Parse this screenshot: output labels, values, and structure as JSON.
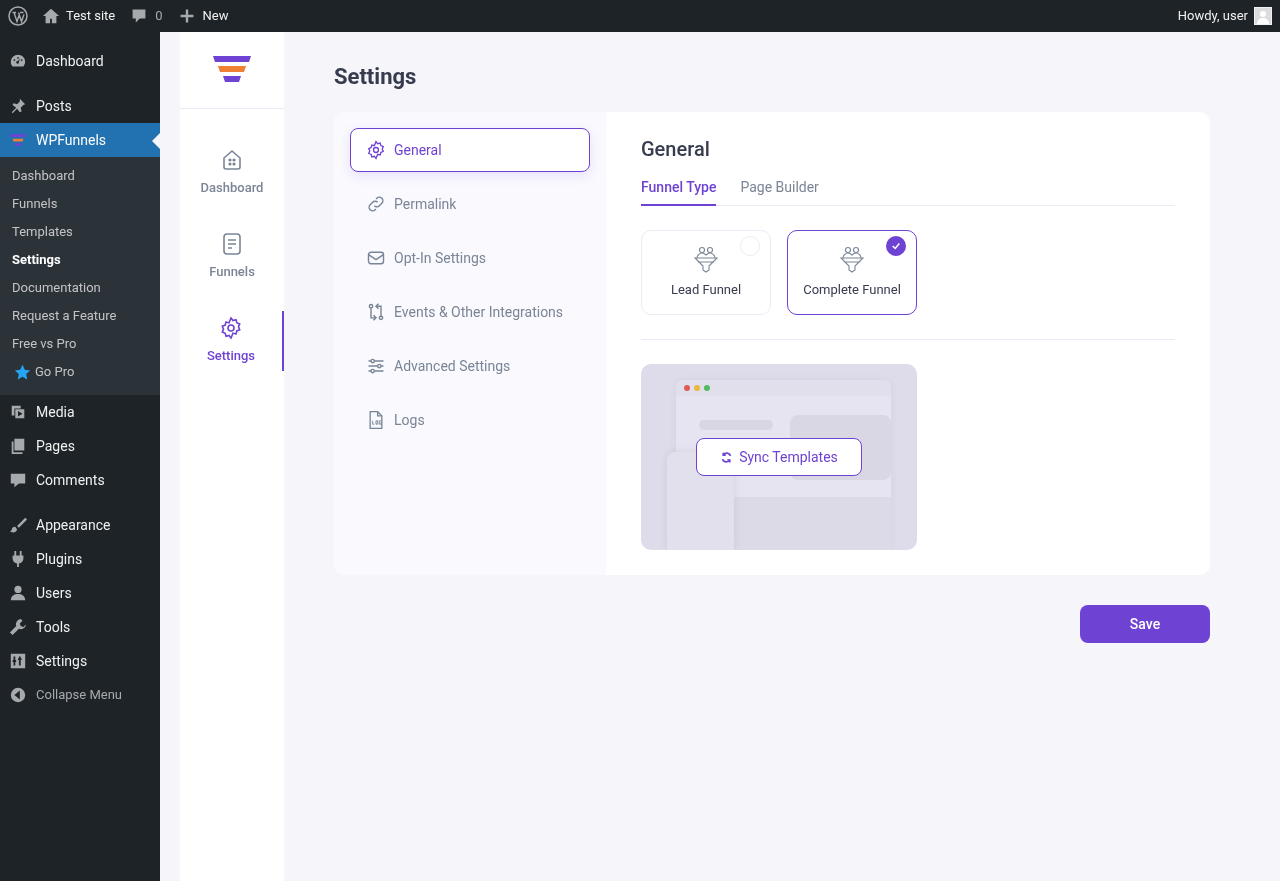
{
  "admin_bar": {
    "site": "Test site",
    "comments": "0",
    "new": "New",
    "greeting": "Howdy, user"
  },
  "wp_menu": [
    {
      "label": "Dashboard",
      "selected": false
    },
    {
      "label": "Posts",
      "selected": false
    },
    {
      "label": "WPFunnels",
      "selected": true,
      "children": [
        {
          "label": "Dashboard",
          "selected": false,
          "kind": "link"
        },
        {
          "label": "Funnels",
          "selected": false,
          "kind": "link"
        },
        {
          "label": "Templates",
          "selected": false,
          "kind": "link"
        },
        {
          "label": "Settings",
          "selected": true,
          "kind": "link"
        },
        {
          "label": "Documentation",
          "selected": false,
          "kind": "link"
        },
        {
          "label": "Request a Feature",
          "selected": false,
          "kind": "link"
        },
        {
          "label": "Free vs Pro",
          "selected": false,
          "kind": "link"
        },
        {
          "label": "Go Pro",
          "selected": false,
          "kind": "promo"
        }
      ]
    },
    {
      "label": "Media",
      "selected": false
    },
    {
      "label": "Pages",
      "selected": false
    },
    {
      "label": "Comments",
      "selected": false
    },
    {
      "label": "Appearance",
      "selected": false
    },
    {
      "label": "Plugins",
      "selected": false
    },
    {
      "label": "Users",
      "selected": false
    },
    {
      "label": "Tools",
      "selected": false
    },
    {
      "label": "Settings",
      "selected": false
    },
    {
      "label": "Collapse Menu",
      "selected": false
    }
  ],
  "plugin_nav": [
    {
      "label": "Dashboard",
      "selected": false
    },
    {
      "label": "Funnels",
      "selected": false
    },
    {
      "label": "Settings",
      "selected": true
    }
  ],
  "page_title": "Settings",
  "settings_menu": [
    {
      "label": "General",
      "selected": true
    },
    {
      "label": "Permalink",
      "selected": false
    },
    {
      "label": "Opt-In Settings",
      "selected": false
    },
    {
      "label": "Events & Other Integrations",
      "selected": false
    },
    {
      "label": "Advanced Settings",
      "selected": false
    },
    {
      "label": "Logs",
      "selected": false
    }
  ],
  "section_title": "General",
  "tabs": [
    {
      "label": "Funnel Type",
      "selected": true
    },
    {
      "label": "Page Builder",
      "selected": false
    }
  ],
  "funnel_types": [
    {
      "label": "Lead Funnel",
      "selected": false
    },
    {
      "label": "Complete Funnel",
      "selected": true
    }
  ],
  "sync_button": "Sync Templates",
  "save_button": "Save"
}
